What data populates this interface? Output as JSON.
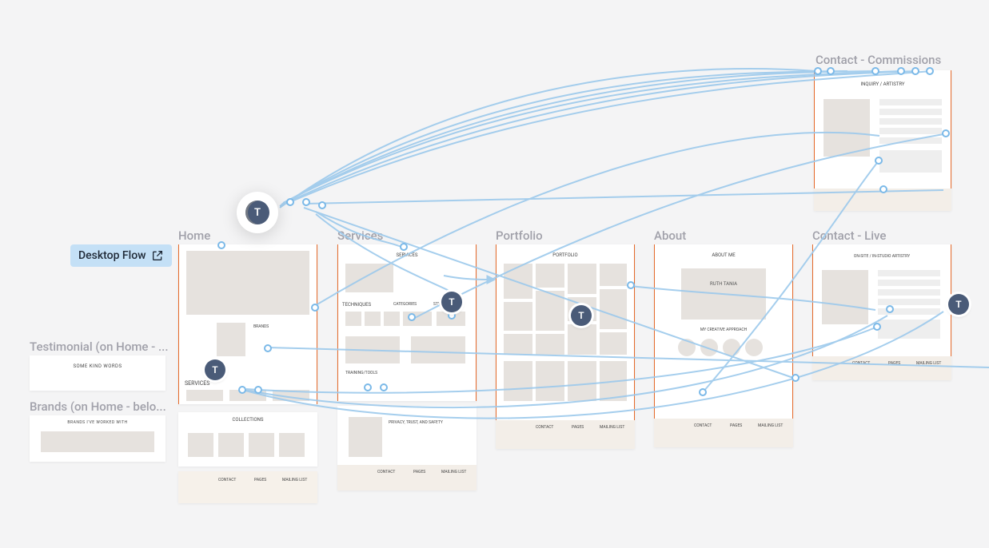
{
  "flow_badge": {
    "label": "Desktop Flow"
  },
  "pages": {
    "contact_commissions": {
      "label": "Contact - Commissions",
      "heading": "INQUIRY / ARTISTRY"
    },
    "home": {
      "label": "Home",
      "sections": {
        "hero_caption": "BRANDS",
        "kind_words": "SOME KIND WORDS",
        "services": "SERVICES",
        "collections": "COLLECTIONS"
      }
    },
    "services": {
      "label": "Services",
      "heading": "SERVICES",
      "sub1": "TECHNIQUES",
      "sub2": "CATEGORIES",
      "sub3": "STYLE TYPE",
      "sub4": "TRAINING/TOOLS",
      "sub5": "PRIVACY, TRUST, AND SAFETY"
    },
    "portfolio": {
      "label": "Portfolio",
      "heading": "PORTFOLIO"
    },
    "about": {
      "label": "About",
      "heading": "ABOUT ME",
      "name": "RUTH TANIA",
      "sub": "MY CREATIVE APPROACH"
    },
    "contact_live": {
      "label": "Contact - Live",
      "heading": "ON-SITE / IN-STUDIO ARTISTRY"
    }
  },
  "side_components": {
    "testimonial": {
      "label": "Testimonial (on Home - ...",
      "heading": "SOME KIND WORDS"
    },
    "brands": {
      "label": "Brands (on Home - belo...",
      "heading": "BRANDS I'VE WORKED WITH"
    }
  },
  "footer": {
    "col1": "CONTACT",
    "col2": "PAGES",
    "col3": "MAILING LIST"
  },
  "avatar_letter": "T"
}
